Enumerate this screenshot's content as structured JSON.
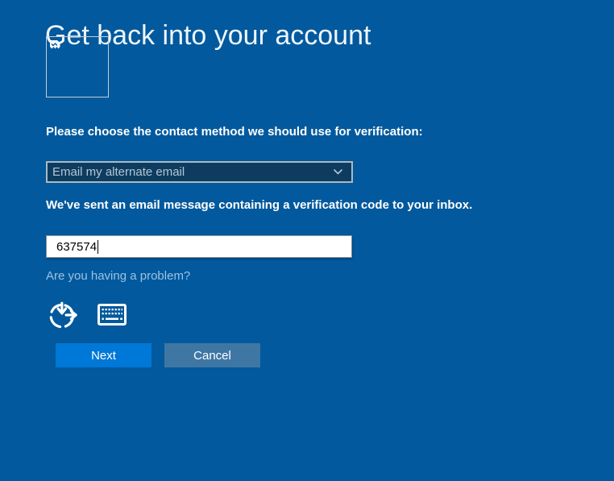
{
  "header": {
    "title": "Get back into your account"
  },
  "image_placeholder": {
    "icon": "broken-image-icon"
  },
  "form": {
    "method_label": "Please choose the contact method we should use for verification:",
    "method_dropdown": {
      "selected": "Email my alternate email",
      "icon": "chevron-down-icon"
    },
    "sent_message": "We've sent an email message containing a verification code to your inbox.",
    "code_field": {
      "value": "637574"
    },
    "problem_link": "Are you having a problem?"
  },
  "accessibility_bar": {
    "icons": [
      "ease-of-access-icon",
      "on-screen-keyboard-icon"
    ]
  },
  "actions": {
    "next": "Next",
    "cancel": "Cancel"
  },
  "colors": {
    "background": "#02599d",
    "next_button": "#0078d7",
    "cancel_button": "#3f77a4",
    "link": "#9cc3e3",
    "dropdown_fill": "#0d3c60",
    "dropdown_border": "#aeb9c1",
    "text": "#ffffff"
  }
}
